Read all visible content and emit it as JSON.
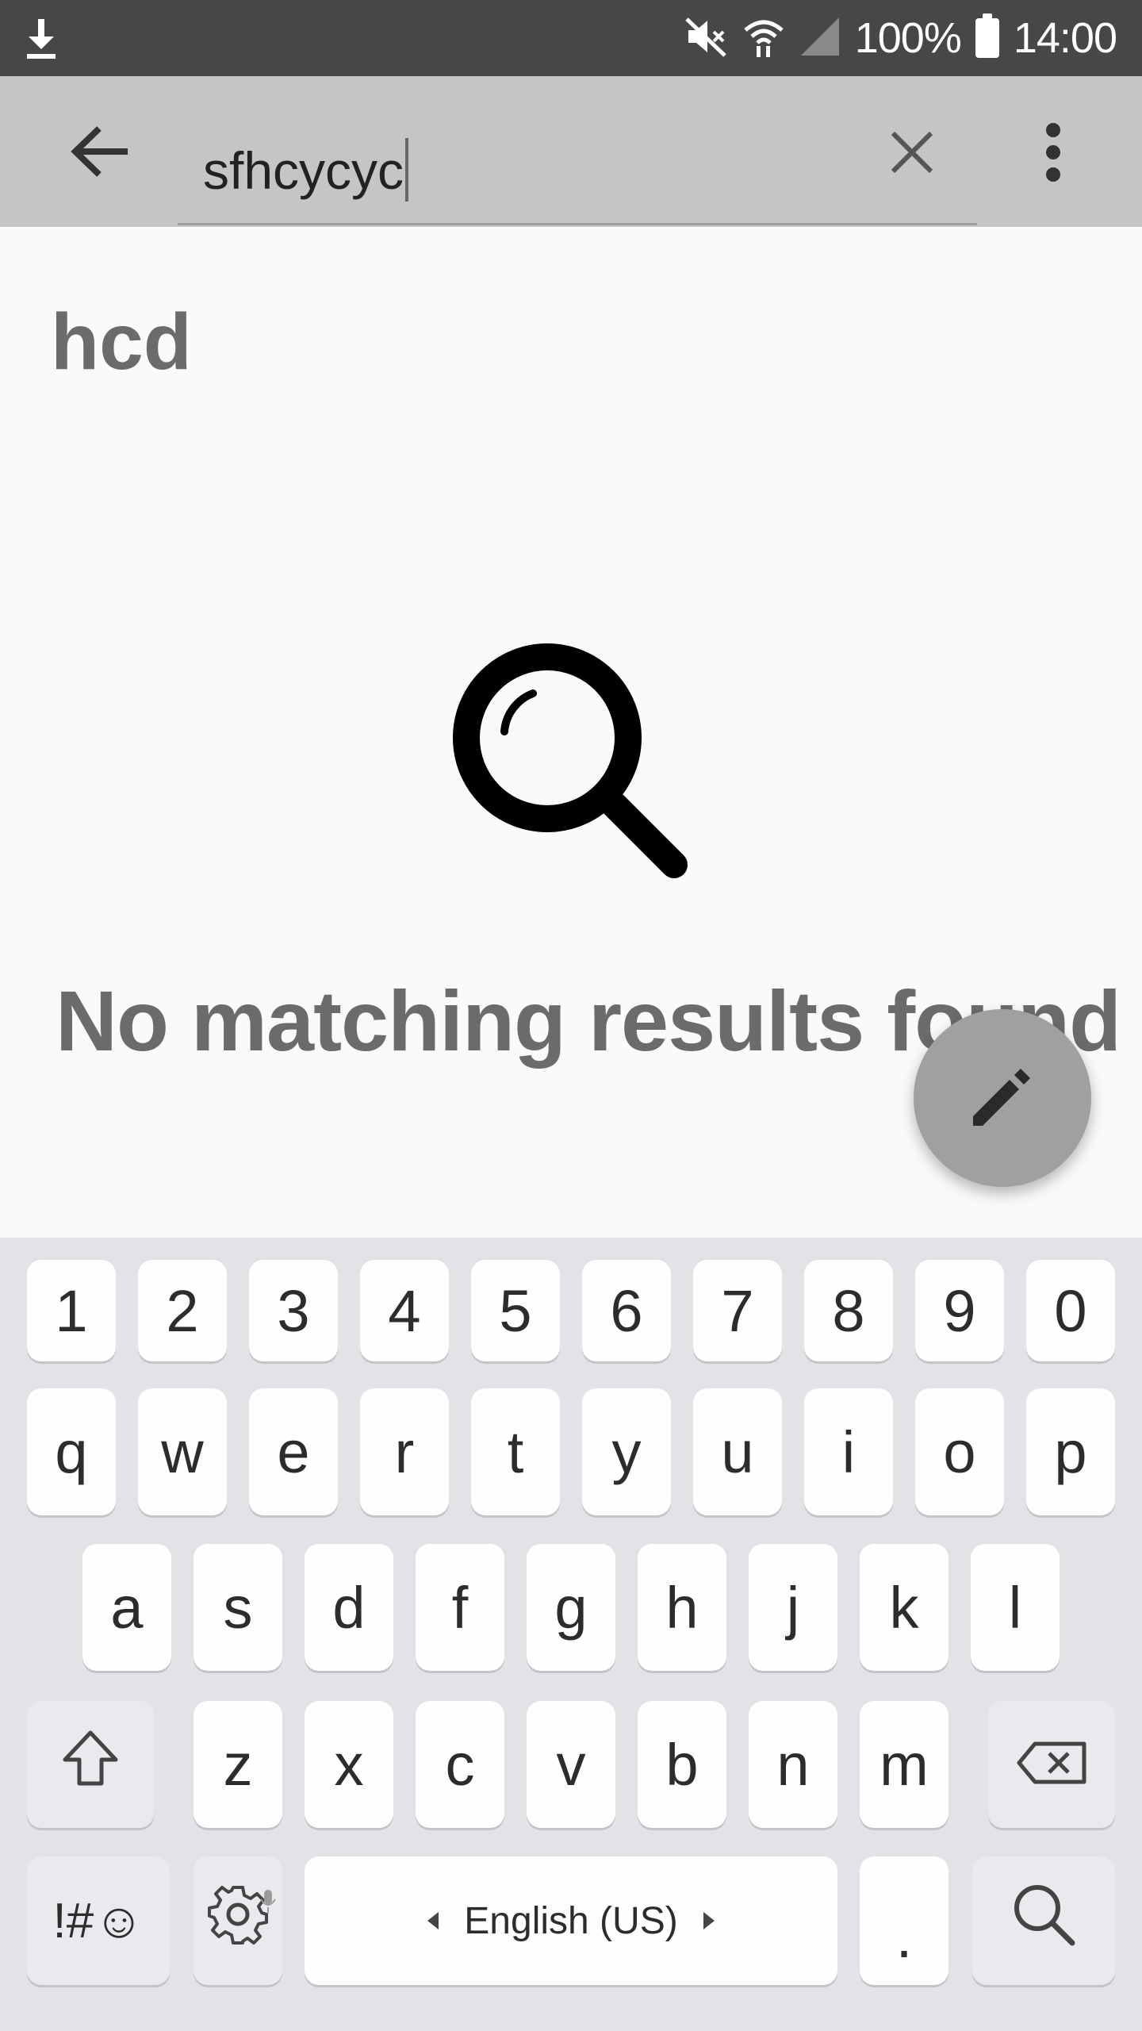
{
  "status_bar": {
    "battery_text": "100%",
    "time": "14:00",
    "icons": [
      "download-icon",
      "mute-icon",
      "wifi-icon",
      "signal-icon",
      "battery-icon"
    ]
  },
  "toolbar": {
    "search_query": "sfhcycyc",
    "icons": [
      "back-arrow-icon",
      "clear-icon",
      "more-vert-icon"
    ]
  },
  "content": {
    "notebook_title": "hcd",
    "empty_message": "No matching results found",
    "empty_icon": "magnifier-icon",
    "fab_icon": "pencil-icon"
  },
  "keyboard": {
    "row_numbers": [
      "1",
      "2",
      "3",
      "4",
      "5",
      "6",
      "7",
      "8",
      "9",
      "0"
    ],
    "row_top": [
      "q",
      "w",
      "e",
      "r",
      "t",
      "y",
      "u",
      "i",
      "o",
      "p"
    ],
    "row_middle": [
      "a",
      "s",
      "d",
      "f",
      "g",
      "h",
      "j",
      "k",
      "l"
    ],
    "row_bottom": [
      "z",
      "x",
      "c",
      "v",
      "b",
      "n",
      "m"
    ],
    "symbols_label": "!#☺",
    "space_label": "English (US)",
    "period_label": ".",
    "function_icons": [
      "shift-icon",
      "backspace-icon",
      "settings-icon",
      "mic-icon",
      "search-key-icon"
    ]
  },
  "colors": {
    "status_bar": "#474747",
    "toolbar": "#c6c5c6",
    "content_bg": "#fafafa",
    "text_gray": "#6b6b6b",
    "fab": "#a0a0a0",
    "keyboard_bg": "#e2e3e7"
  }
}
